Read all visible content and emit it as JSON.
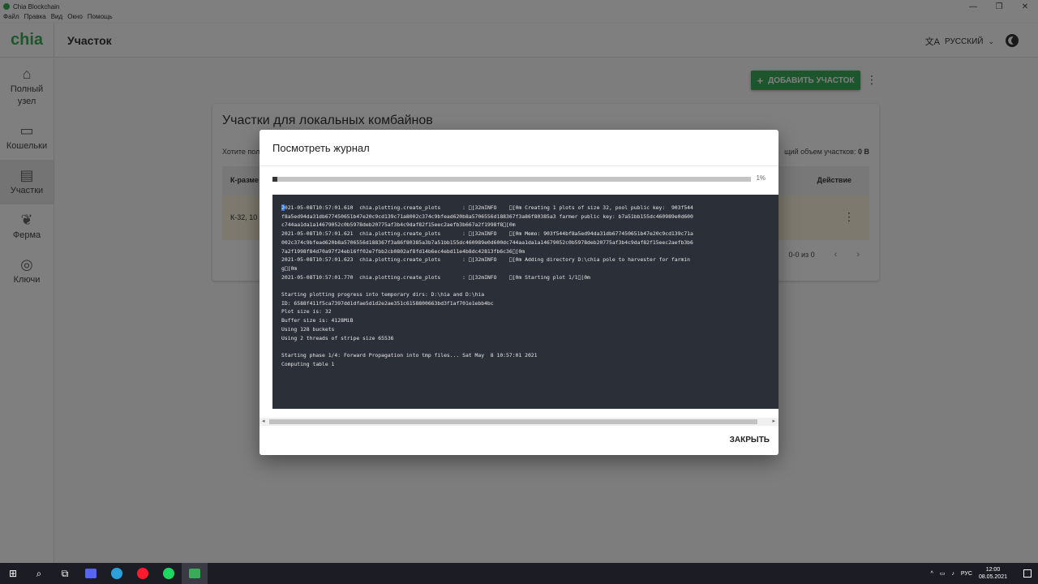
{
  "window": {
    "title": "Chia Blockchain",
    "menu": [
      "Файл",
      "Правка",
      "Вид",
      "Окно",
      "Помощь"
    ]
  },
  "header": {
    "logo": "chia",
    "page_title": "Участок",
    "language": "РУССКИЙ"
  },
  "sidebar": {
    "items": [
      {
        "label": "Полный узел",
        "icon": "home-icon"
      },
      {
        "label": "Кошельки",
        "icon": "wallet-icon"
      },
      {
        "label": "Участки",
        "icon": "hdd-icon",
        "active": true
      },
      {
        "label": "Ферма",
        "icon": "sprout-icon"
      },
      {
        "label": "Ключи",
        "icon": "lifebuoy-icon"
      }
    ]
  },
  "main": {
    "add_plot_label": "ДОБАВИТЬ УЧАСТОК",
    "card_title": "Участки для локальных комбайнов",
    "description": "Хотите пол",
    "total_label": "щий объем участков:",
    "total_value": "0 B",
    "columns": {
      "k_size": "К-разме",
      "action": "Действие"
    },
    "row": {
      "k": "К-32, 10"
    },
    "pagination": "0-0 из 0"
  },
  "dialog": {
    "title": "Посмотреть журнал",
    "progress": 0.01,
    "progress_label": "1%",
    "log_first_char": "2",
    "log_rest": "021-05-08T10:57:01.610  chia.plotting.create_plots       : \u0000[32mINFO    \u0000[0m Creating 1 plots of size 32, pool public key:  903f544\nf8a5ed94da31db677450651b47e20c9cd139c71a8002c374c9bfead620b8a5706556d188367f3a86f80385a3 farmer public key: b7a51bb155dc460989e0d600\nc744aa1da1a14679052c0b5978deb20775af3b4c9daf82f15eec2aefb3b667a2f1998f8\u0000[0m\n2021-05-08T10:57:01.621  chia.plotting.create_plots       : \u0000[32mINFO    \u0000[0m Memo: 903f544bf8a5ed94da31db677450651b47e20c9cd139c71a\n002c374c9bfead620b8a5706556d188367f3a86f80385a3b7a51bb155dc460989e0d600dc744aa1da1a14679052c0b5978deb20775af3b4c9daf82f15eec2aefb3b6\n7a2f1998f84d70a97f24eb16ff02e7fbb2cb0802af8fd14b6ec4ebd11e4b8dc42813fb6c36\u0000[0m\n2021-05-08T10:57:01.623  chia.plotting.create_plots       : \u0000[32mINFO    \u0000[0m Adding directory D:\\chia pole to harvester for farmin\ng\u0000[0m\n2021-05-08T10:57:01.770  chia.plotting.create_plots       : \u0000[32mINFO    \u0000[0m Starting plot 1/1\u0000[0m\n\nStarting plotting progress into temporary dirs: D:\\hia and D:\\hia\nID: 6588f411f5ca7397dd1dfae5d1d2e2ae351c6158800663bd3f1af701e1ebb4bc\nPlot size is: 32\nBuffer size is: 4128MiB\nUsing 128 buckets\nUsing 2 threads of stripe size 65536\n\nStarting phase 1/4: Forward Propagation into tmp files... Sat May  8 10:57:01 2021\nComputing table 1",
    "close_label": "ЗАКРЫТЬ"
  },
  "taskbar": {
    "lang": "РУС",
    "time": "12:00",
    "date": "08.05.2021"
  }
}
